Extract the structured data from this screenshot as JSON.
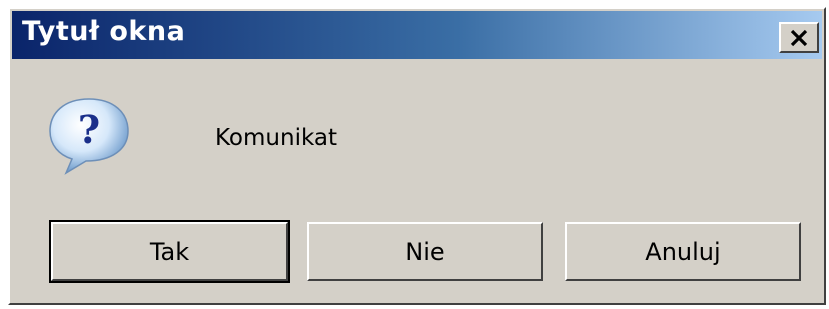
{
  "window": {
    "title": "Tytuł okna"
  },
  "dialog": {
    "message": "Komunikat",
    "icon": "question-icon"
  },
  "buttons": {
    "yes_label": "Tak",
    "no_label": "Nie",
    "cancel_label": "Anuluj"
  },
  "colors": {
    "titlebar_start": "#0a246a",
    "titlebar_end": "#a6caf0",
    "face": "#d4d0c8"
  }
}
